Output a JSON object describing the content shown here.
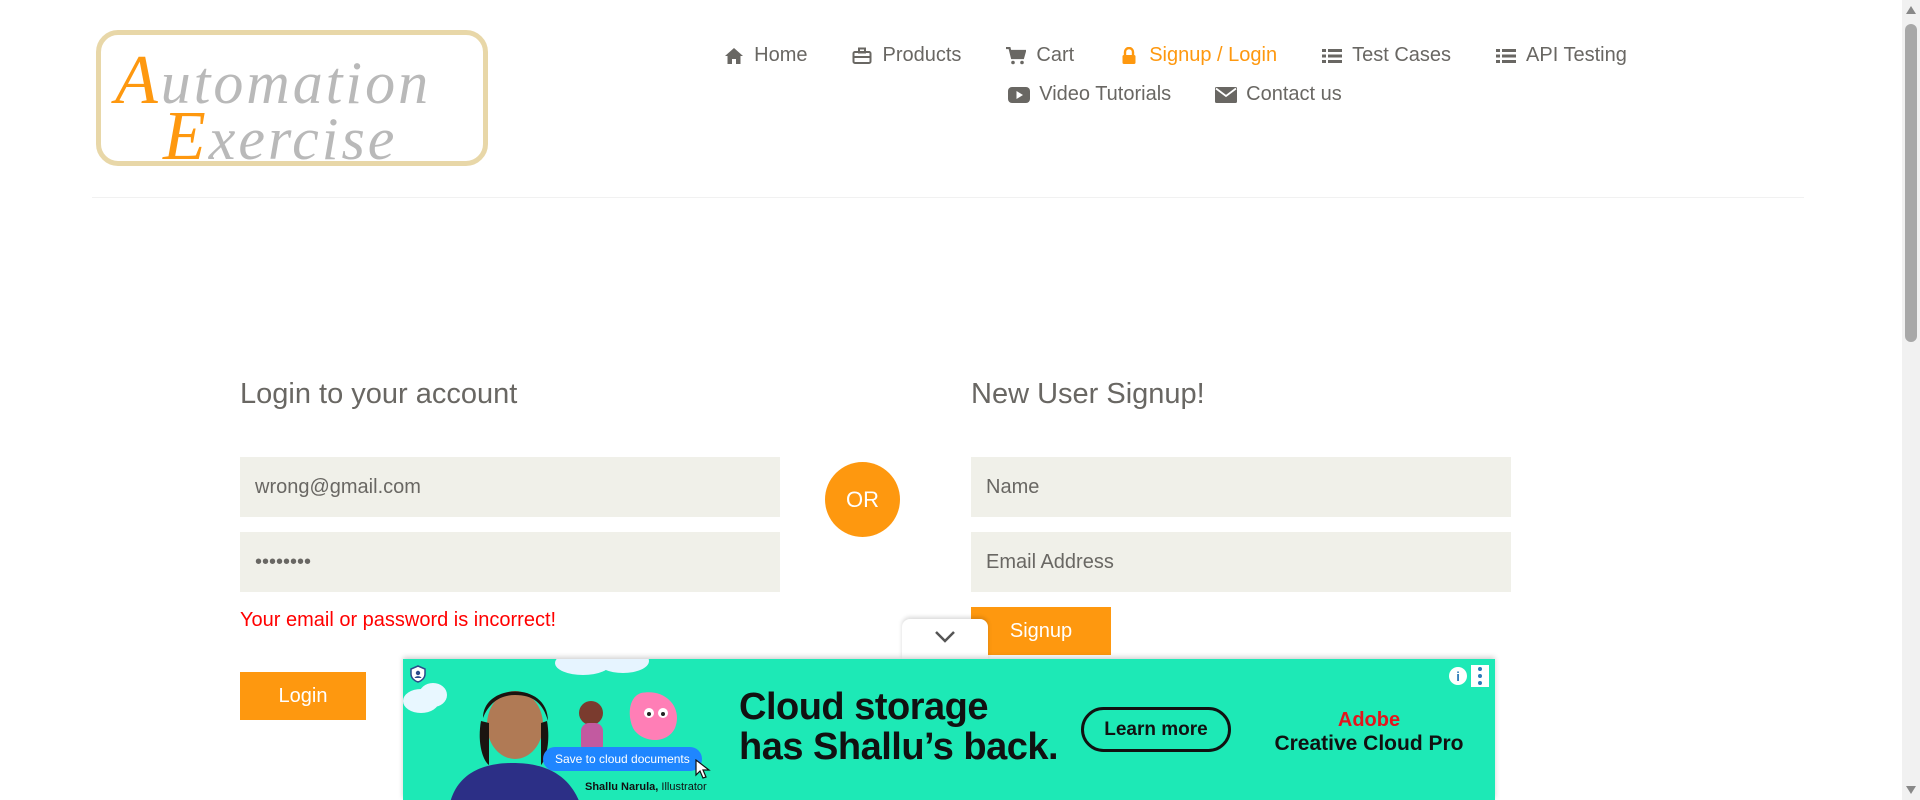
{
  "logo": {
    "line1_cap": "A",
    "line1_rest": "utomation",
    "line2_cap": "E",
    "line2_rest": "xercise"
  },
  "nav": {
    "items": [
      {
        "label": "Home",
        "icon": "home-icon"
      },
      {
        "label": "Products",
        "icon": "products-icon"
      },
      {
        "label": "Cart",
        "icon": "cart-icon"
      },
      {
        "label": "Signup / Login",
        "icon": "lock-icon",
        "active": true
      },
      {
        "label": "Test Cases",
        "icon": "list-icon"
      },
      {
        "label": "API Testing",
        "icon": "list-icon"
      },
      {
        "label": "Video Tutorials",
        "icon": "youtube-play-icon"
      },
      {
        "label": "Contact us",
        "icon": "envelope-icon"
      }
    ]
  },
  "login": {
    "title": "Login to your account",
    "email_value": "wrong@gmail.com",
    "password_value": "••••••••",
    "error": "Your email or password is incorrect!",
    "button": "Login"
  },
  "divider": {
    "label": "OR"
  },
  "signup": {
    "title": "New User Signup!",
    "name_placeholder": "Name",
    "email_placeholder": "Email Address",
    "button": "Signup"
  },
  "ad": {
    "chip": "Save to cloud documents",
    "credit_name": "Shallu Narula,",
    "credit_role": " Illustrator",
    "headline_line1": "Cloud storage",
    "headline_line2": "has Shallu’s back.",
    "cta": "Learn more",
    "brand_line1": "Adobe",
    "brand_line2": "Creative Cloud Pro",
    "info_symbol": "i"
  },
  "colors": {
    "accent": "#fe980f",
    "text": "#696763",
    "field_bg": "#f0f0e9",
    "error": "#ff0000",
    "ad_bg": "#1de9b6"
  }
}
